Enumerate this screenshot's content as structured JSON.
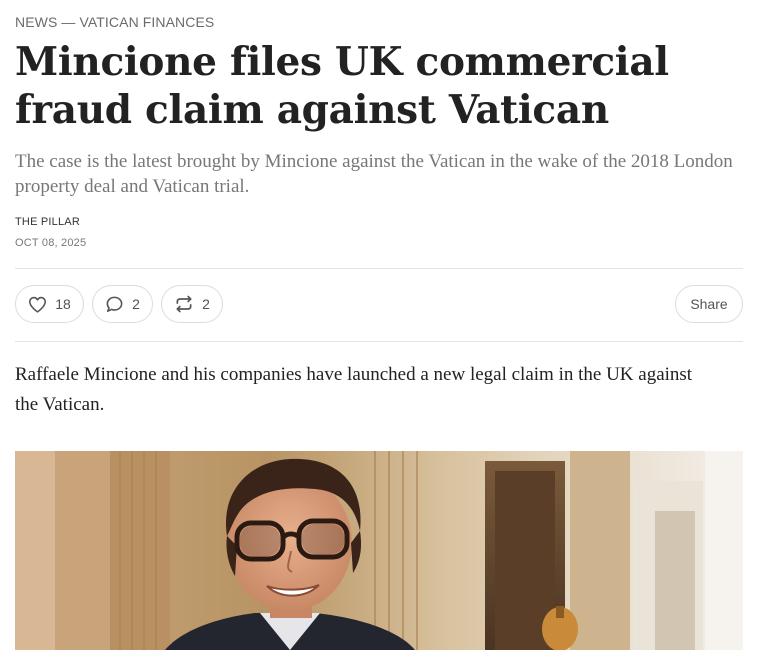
{
  "article": {
    "kicker": "NEWS — VATICAN FINANCES",
    "title": "Mincione files UK commercial fraud claim against Vatican",
    "subtitle": "The case is the latest brought by Mincione against the Vatican in the wake of the 2018 London property deal and Vatican trial.",
    "publisher": "THE PILLAR",
    "date": "OCT 08, 2025",
    "lead": "Raffaele Mincione and his companies have launched a new legal claim in the UK against the Vatican."
  },
  "actions": {
    "like_count": "18",
    "comment_count": "2",
    "restack_count": "2",
    "share_label": "Share",
    "icons": [
      "heart-icon",
      "comment-icon",
      "restack-icon"
    ]
  },
  "colors": {
    "title": "#222222",
    "subtitle": "#777777",
    "divider": "#e4e4e4"
  }
}
